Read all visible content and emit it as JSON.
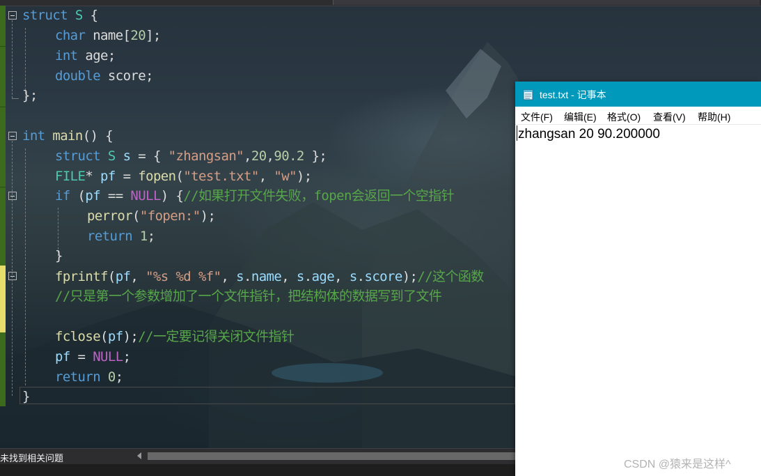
{
  "editor": {
    "lines": [
      [
        {
          "c": "kw",
          "t": "struct"
        },
        {
          "c": "plain",
          "t": " "
        },
        {
          "c": "ty",
          "t": "S"
        },
        {
          "c": "plain",
          "t": " {"
        }
      ],
      [
        {
          "c": "kw",
          "t": "char"
        },
        {
          "c": "plain",
          "t": " name["
        },
        {
          "c": "num",
          "t": "20"
        },
        {
          "c": "plain",
          "t": "];"
        }
      ],
      [
        {
          "c": "kw",
          "t": "int"
        },
        {
          "c": "plain",
          "t": " age;"
        }
      ],
      [
        {
          "c": "kw",
          "t": "double"
        },
        {
          "c": "plain",
          "t": " score;"
        }
      ],
      [
        {
          "c": "plain",
          "t": "};"
        }
      ],
      [],
      [
        {
          "c": "kw",
          "t": "int"
        },
        {
          "c": "plain",
          "t": " "
        },
        {
          "c": "fn",
          "t": "main"
        },
        {
          "c": "plain",
          "t": "() {"
        }
      ],
      [
        {
          "c": "kw",
          "t": "struct"
        },
        {
          "c": "plain",
          "t": " "
        },
        {
          "c": "ty",
          "t": "S"
        },
        {
          "c": "plain",
          "t": " "
        },
        {
          "c": "var",
          "t": "s"
        },
        {
          "c": "plain",
          "t": " = { "
        },
        {
          "c": "str",
          "t": "\"zhangsan\""
        },
        {
          "c": "plain",
          "t": ","
        },
        {
          "c": "num",
          "t": "20"
        },
        {
          "c": "plain",
          "t": ","
        },
        {
          "c": "num",
          "t": "90.2"
        },
        {
          "c": "plain",
          "t": " };"
        }
      ],
      [
        {
          "c": "ty",
          "t": "FILE"
        },
        {
          "c": "plain",
          "t": "* "
        },
        {
          "c": "var",
          "t": "pf"
        },
        {
          "c": "plain",
          "t": " = "
        },
        {
          "c": "fn",
          "t": "fopen"
        },
        {
          "c": "plain",
          "t": "("
        },
        {
          "c": "str",
          "t": "\"test.txt\""
        },
        {
          "c": "plain",
          "t": ", "
        },
        {
          "c": "str",
          "t": "\"w\""
        },
        {
          "c": "plain",
          "t": ");"
        }
      ],
      [
        {
          "c": "kw",
          "t": "if"
        },
        {
          "c": "plain",
          "t": " ("
        },
        {
          "c": "var",
          "t": "pf"
        },
        {
          "c": "plain",
          "t": " == "
        },
        {
          "c": "mac",
          "t": "NULL"
        },
        {
          "c": "plain",
          "t": ") {"
        },
        {
          "c": "cmt",
          "t": "//如果打开文件失败，fopen会返回一个空指针"
        }
      ],
      [
        {
          "c": "fn",
          "t": "perror"
        },
        {
          "c": "plain",
          "t": "("
        },
        {
          "c": "str",
          "t": "\"fopen:\""
        },
        {
          "c": "plain",
          "t": ");"
        }
      ],
      [
        {
          "c": "kw",
          "t": "return"
        },
        {
          "c": "plain",
          "t": " "
        },
        {
          "c": "num",
          "t": "1"
        },
        {
          "c": "plain",
          "t": ";"
        }
      ],
      [
        {
          "c": "plain",
          "t": "}"
        }
      ],
      [
        {
          "c": "fn",
          "t": "fprintf"
        },
        {
          "c": "plain",
          "t": "("
        },
        {
          "c": "var",
          "t": "pf"
        },
        {
          "c": "plain",
          "t": ", "
        },
        {
          "c": "str",
          "t": "\"%s %d %f\""
        },
        {
          "c": "plain",
          "t": ", "
        },
        {
          "c": "var",
          "t": "s"
        },
        {
          "c": "plain",
          "t": "."
        },
        {
          "c": "var",
          "t": "name"
        },
        {
          "c": "plain",
          "t": ", "
        },
        {
          "c": "var",
          "t": "s"
        },
        {
          "c": "plain",
          "t": "."
        },
        {
          "c": "var",
          "t": "age"
        },
        {
          "c": "plain",
          "t": ", "
        },
        {
          "c": "var",
          "t": "s"
        },
        {
          "c": "plain",
          "t": "."
        },
        {
          "c": "var",
          "t": "score"
        },
        {
          "c": "plain",
          "t": ");"
        },
        {
          "c": "cmt",
          "t": "//这个函数"
        }
      ],
      [
        {
          "c": "cmt",
          "t": "//只是第一个参数增加了一个文件指针，把结构体的数据写到了文件"
        }
      ],
      [],
      [
        {
          "c": "fn",
          "t": "fclose"
        },
        {
          "c": "plain",
          "t": "("
        },
        {
          "c": "var",
          "t": "pf"
        },
        {
          "c": "plain",
          "t": ");"
        },
        {
          "c": "cmt",
          "t": "//一定要记得关闭文件指针"
        }
      ],
      [
        {
          "c": "var",
          "t": "pf"
        },
        {
          "c": "plain",
          "t": " = "
        },
        {
          "c": "mac",
          "t": "NULL"
        },
        {
          "c": "plain",
          "t": ";"
        }
      ],
      [
        {
          "c": "kw",
          "t": "return"
        },
        {
          "c": "plain",
          "t": " "
        },
        {
          "c": "num",
          "t": "0"
        },
        {
          "c": "plain",
          "t": ";"
        }
      ],
      [
        {
          "c": "plain",
          "t": "}"
        }
      ]
    ]
  },
  "status_bar": {
    "issues_text": "未找到相关问题"
  },
  "notepad": {
    "title": "test.txt - 记事本",
    "menu": [
      "文件(F)",
      "编辑(E)",
      "格式(O)",
      "查看(V)",
      "帮助(H)"
    ],
    "content": "zhangsan 20 90.200000"
  },
  "watermark": "CSDN @猿来是这样^",
  "icons": {
    "fold": "collapse-icon",
    "notepad": "notepad-icon",
    "scroll_left": "scroll-left-arrow-icon"
  }
}
